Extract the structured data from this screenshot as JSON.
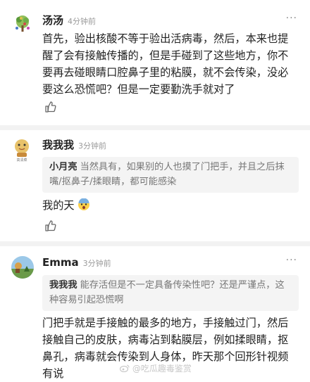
{
  "comments": [
    {
      "name": "汤汤",
      "time": "4分钟前",
      "text": "首先，验出核酸不等于验出活病毒，然后，本来也提醒了会有接触传播的，但是手碰到了这些地方，你不要再去碰眼睛口腔鼻子里的粘膜，就不会传染，没必要这么恐慌吧？但是一定要勤洗手就对了",
      "avatar_icon": "tree-avatar-icon"
    },
    {
      "name": "我我我",
      "time": "3分钟前",
      "quote_name": "小月亮",
      "quote_text": "当然具有，如果别的人也摸了门把手，并且之后抹嘴/抠鼻子/揉眼睛，都可能感染",
      "text": "我的天",
      "emoji": "scared-face-emoji",
      "avatar_icon": "cartoon-avatar-icon",
      "avatar_caption": "高清菜"
    },
    {
      "name": "Emma",
      "time": "3分钟前",
      "quote_name": "我我我",
      "quote_text": "能存活但是不一定具备传染性吧？还是严谨点，这种容易引起恐慌啊",
      "text": "门把手就是手接触的最多的地方，手接触过门，然后接触自己的皮肤，病毒沾到黏膜层，例如揉眼睛，抠鼻孔，病毒就会传染到人身体，昨天那个回形针视频有说",
      "avatar_icon": "landscape-avatar-icon"
    }
  ],
  "more_label": "···",
  "watermark": "@吃瓜趣毒鉴赏",
  "colors": {
    "divider": "#f2f2f2",
    "quote_bg": "#f4f4f4",
    "time": "#9a9a9a"
  }
}
